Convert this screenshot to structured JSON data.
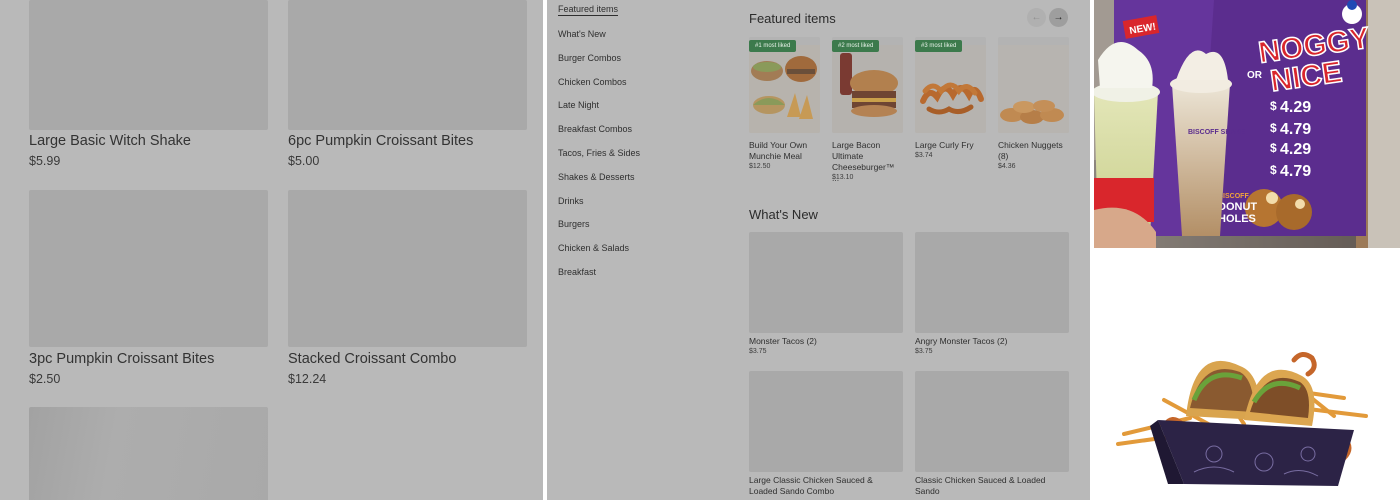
{
  "product_grid": {
    "items": [
      {
        "name": "Large Basic Witch Shake",
        "price": "$5.99"
      },
      {
        "name": "6pc Pumpkin Croissant Bites",
        "price": "$5.00"
      },
      {
        "name": "3pc Pumpkin Croissant Bites",
        "price": "$2.50"
      },
      {
        "name": "Stacked Croissant Combo",
        "price": "$12.24"
      }
    ]
  },
  "sidebar": {
    "items": [
      {
        "label": "Featured items"
      },
      {
        "label": "What's New"
      },
      {
        "label": "Burger Combos"
      },
      {
        "label": "Chicken Combos"
      },
      {
        "label": "Late Night"
      },
      {
        "label": "Breakfast Combos"
      },
      {
        "label": "Tacos, Fries & Sides"
      },
      {
        "label": "Shakes & Desserts"
      },
      {
        "label": "Drinks"
      },
      {
        "label": "Burgers"
      },
      {
        "label": "Chicken & Salads"
      },
      {
        "label": "Breakfast"
      }
    ]
  },
  "featured": {
    "title": "Featured items",
    "prev_icon": "arrow-left-icon",
    "next_icon": "arrow-right-icon",
    "items": [
      {
        "badge": "#1 most liked",
        "name": "Build Your Own Munchie Meal",
        "price": "$12.50"
      },
      {
        "badge": "#2 most liked",
        "name": "Large Bacon Ultimate Cheeseburger™ ...",
        "price": "$13.10"
      },
      {
        "badge": "#3 most liked",
        "name": "Large Curly Fry",
        "price": "$3.74"
      },
      {
        "badge": "",
        "name": "Chicken Nuggets (8)",
        "price": "$4.36"
      }
    ]
  },
  "whats_new": {
    "title": "What's New",
    "items": [
      {
        "name": "Monster Tacos (2)",
        "price": "$3.75"
      },
      {
        "name": "Angry Monster Tacos (2)",
        "price": "$3.75"
      },
      {
        "name": "Large Classic Chicken Sauced & Loaded Sando Combo",
        "price": ""
      },
      {
        "name": "Classic Chicken Sauced & Loaded Sando",
        "price": ""
      }
    ]
  },
  "promo_photo": {
    "badge": "NEW!",
    "headline_1": "NOGGY",
    "headline_or": "OR",
    "headline_2": "NICE",
    "prices": [
      "4.29",
      "4.79",
      "4.29",
      "4.79"
    ],
    "donut_label_1": "BISCOFF",
    "donut_label_2": "DONUT",
    "donut_label_3": "HOLES",
    "cup_label": "BISCOFF SHAKE",
    "accent_color": "#5b2d8e",
    "headline_color": "#d9262c"
  },
  "colors": {
    "overlay_gray": "#b9b9b9",
    "placeholder": "#a9a9a9",
    "badge_green": "#3c7a4c"
  }
}
